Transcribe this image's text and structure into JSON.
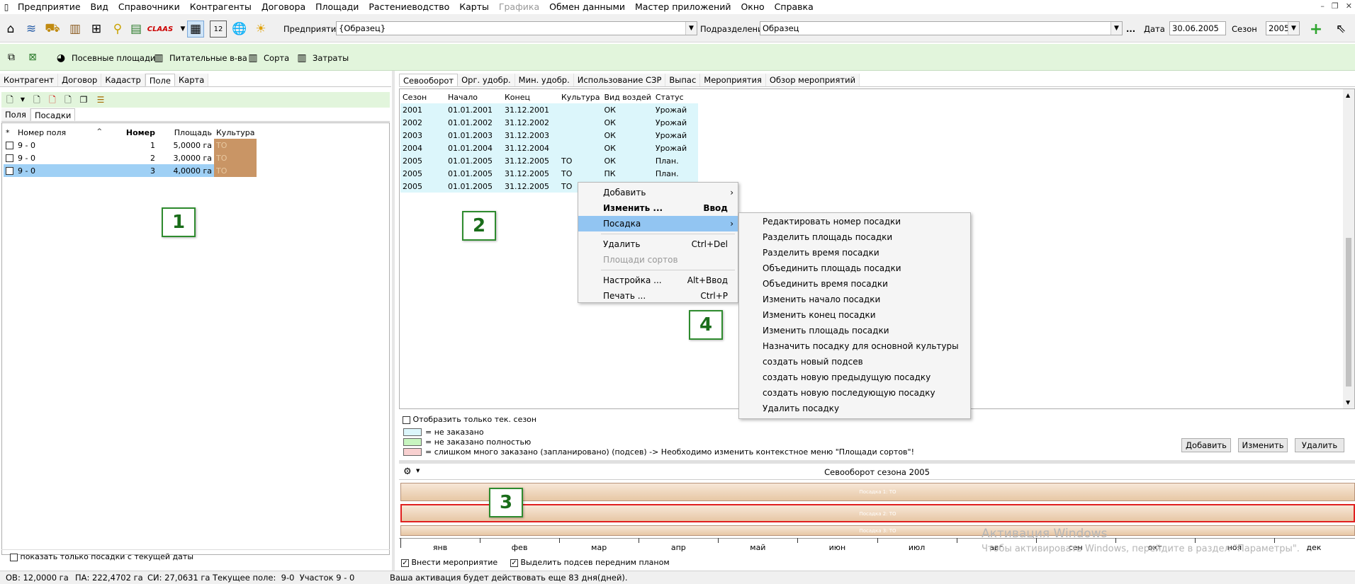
{
  "menubar": {
    "items": [
      "Предприятие",
      "Вид",
      "Справочники",
      "Контрагенты",
      "Договора",
      "Площади",
      "Растениеводство",
      "Карты",
      "Графика",
      "Обмен данными",
      "Мастер приложений",
      "Окно",
      "Справка"
    ]
  },
  "toolbar": {
    "enterprise_label": "Предприятие",
    "enterprise_value": "{Образец}",
    "division_label": "Подразделение",
    "division_value": "Образец",
    "more": "...",
    "date_label": "Дата",
    "date_value": "30.06.2005",
    "season_label": "Сезон",
    "season_value": "2005",
    "calendar_day": "12"
  },
  "toolbar2": {
    "items": [
      "Посевные площади",
      "Питательные в-ва",
      "Сорта",
      "Затраты"
    ]
  },
  "left": {
    "tabs": [
      "Контрагент",
      "Договор",
      "Кадастр",
      "Поле",
      "Карта"
    ],
    "subtabs": [
      "Поля",
      "Посадки"
    ],
    "columns": [
      "*",
      "Номер поля",
      "Номер",
      "Площадь",
      "Культура"
    ],
    "rows": [
      {
        "field": "9 - 0",
        "num": "1",
        "area": "5,0000 га",
        "crop": "ТО"
      },
      {
        "field": "9 - 0",
        "num": "2",
        "area": "3,0000 га",
        "crop": "ТО"
      },
      {
        "field": "9 - 0",
        "num": "3",
        "area": "4,0000 га",
        "crop": "ТО"
      }
    ],
    "footer_checkbox": "показать только посадки с текущей даты"
  },
  "right": {
    "tabs": [
      "Севооборот",
      "Орг. удобр.",
      "Мин. удобр.",
      "Использование СЗР",
      "Выпас",
      "Мероприятия",
      "Обзор мероприятий"
    ],
    "columns": [
      "Сезон",
      "Начало",
      "Конец",
      "Культура",
      "Вид воздей",
      "Статус"
    ],
    "rows": [
      {
        "season": "2001",
        "start": "01.01.2001",
        "end": "31.12.2001",
        "crop": "",
        "type": "ОК",
        "status": "Урожай"
      },
      {
        "season": "2002",
        "start": "01.01.2002",
        "end": "31.12.2002",
        "crop": "",
        "type": "ОК",
        "status": "Урожай"
      },
      {
        "season": "2003",
        "start": "01.01.2003",
        "end": "31.12.2003",
        "crop": "",
        "type": "ОК",
        "status": "Урожай"
      },
      {
        "season": "2004",
        "start": "01.01.2004",
        "end": "31.12.2004",
        "crop": "",
        "type": "ОК",
        "status": "Урожай"
      },
      {
        "season": "2005",
        "start": "01.01.2005",
        "end": "31.12.2005",
        "crop": "ТО",
        "type": "ОК",
        "status": "План."
      },
      {
        "season": "2005",
        "start": "01.01.2005",
        "end": "31.12.2005",
        "crop": "ТО",
        "type": "ПК",
        "status": "План."
      },
      {
        "season": "2005",
        "start": "01.01.2005",
        "end": "31.12.2005",
        "crop": "ТО",
        "type": "",
        "status": ""
      }
    ],
    "only_current_season": "Отобразить только тек. сезон",
    "legend": [
      "= не заказано",
      "= не заказано полностью",
      "= слишком много заказано (запланировано) (подсев) -> Необходимо изменить контекстное меню \"Площади сортов\"!"
    ],
    "buttons": {
      "add": "Добавить",
      "edit": "Изменить",
      "delete": "Удалить"
    }
  },
  "context_menu": [
    {
      "label": "Добавить",
      "shortcut": "",
      "sub": true
    },
    {
      "label": "Изменить ...",
      "shortcut": "Ввод",
      "bold": true
    },
    {
      "label": "Посадка",
      "shortcut": "",
      "sub": true,
      "highlight": true
    },
    {
      "label": "Удалить",
      "shortcut": "Ctrl+Del"
    },
    {
      "label": "Площади сортов",
      "shortcut": "",
      "disabled": true
    },
    {
      "label": "Настройка ...",
      "shortcut": "Alt+Ввод"
    },
    {
      "label": "Печать ...",
      "shortcut": "Ctrl+P"
    }
  ],
  "submenu": [
    "Редактировать номер посадки",
    "Разделить площадь посадки",
    "Разделить время посадки",
    "Объединить площадь посадки",
    "Объединить время посадки",
    "Изменить начало посадки",
    "Изменить конец посадки",
    "Изменить площадь посадки",
    "Назначить посадку для основной культуры",
    "создать новый подсев",
    "создать новую предыдущую посадку",
    "создать новую последующую посадку",
    "Удалить посадку"
  ],
  "timeline": {
    "title": "Севооборот сезона 2005",
    "bars": [
      "Посадка 1: ТО",
      "Посадка 2: ТО",
      "Посадка 3: ТО"
    ],
    "months": [
      "янв",
      "фев",
      "мар",
      "апр",
      "май",
      "июн",
      "июл",
      "авг",
      "сен",
      "окт",
      "ноя",
      "дек"
    ],
    "check1": "Внести мероприятие",
    "check2": "Выделить подсев передним планом"
  },
  "status": {
    "ov": "ОВ: 12,0000 га",
    "pa": "ПА: 222,4702 га",
    "si": "СИ: 27,0631 га",
    "current_field": "Текущее поле:  9-0  Участок 9 - 0",
    "activation": "Ваша активация будет действовать еще 83 дня(дней)."
  },
  "watermark": {
    "title": "Активация Windows",
    "text": "Чтобы активировать Windows, перейдите в раздел \"Параметры\"."
  },
  "badges": [
    "1",
    "2",
    "3",
    "4"
  ],
  "colors": {
    "crop": "#c99565",
    "row_light": "#dcf6fb",
    "selected": "#9fd0f5",
    "menu_highlight": "#92c5f2",
    "green_bar": "#e2f5dc"
  }
}
